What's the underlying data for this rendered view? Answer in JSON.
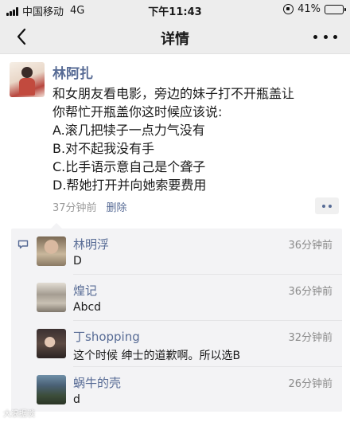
{
  "status_bar": {
    "carrier": "中国移动",
    "network": "4G",
    "time": "下午11:43",
    "battery_percent": "41%",
    "battery_level": 0.41
  },
  "nav": {
    "title": "详情"
  },
  "post": {
    "author": "林阿扎",
    "lines": [
      "和女朋友看电影，旁边的妹子打不开瓶盖让",
      "你帮忙开瓶盖你这时候应该说:",
      "A.滚几把犊子一点力气没有",
      "B.对不起我没有手",
      "C.比手语示意自己是个聋子",
      "D.帮她打开并向她索要费用"
    ],
    "time": "37分钟前",
    "delete_label": "删除"
  },
  "comments": [
    {
      "name": "林明浮",
      "time": "36分钟前",
      "text": "D"
    },
    {
      "name": "煌记",
      "time": "36分钟前",
      "text": "Abcd"
    },
    {
      "name": "丁shopping",
      "time": "32分钟前",
      "text": "这个时候 绅士的道歉啊。所以选B"
    },
    {
      "name": "蜗牛的壳",
      "time": "26分钟前",
      "text": "d"
    }
  ],
  "watermark": "大浪据谈",
  "colors": {
    "link_blue": "#576b95",
    "bar_bg": "#ededed",
    "comment_bg": "#f3f3f5"
  }
}
